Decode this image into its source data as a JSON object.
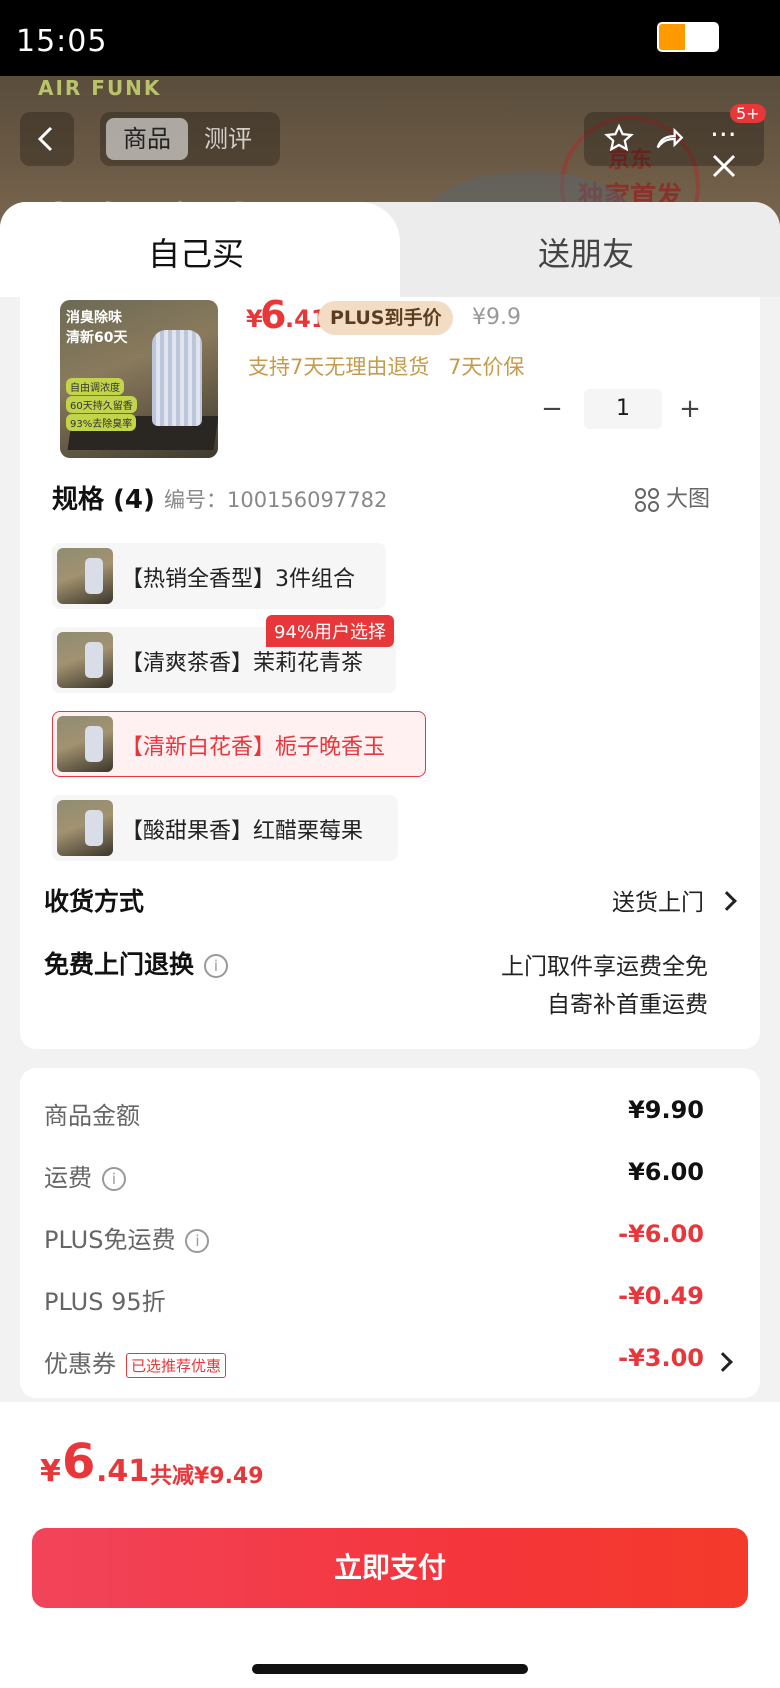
{
  "status_bar": {
    "time": "15:05",
    "battery_level": 0.45,
    "battery_color": "#ff9900"
  },
  "background_page": {
    "brand": "AIR FUNK",
    "tabs": [
      "商品",
      "测评"
    ],
    "badge": "5+",
    "stamp": [
      "京东",
      "独家首发"
    ],
    "headline": "消臭除味"
  },
  "sheet_tabs": {
    "self": "自己买",
    "gift": "送朋友"
  },
  "product": {
    "image_text": [
      "消臭除味",
      "清新60天",
      "自由调浓度",
      "60天持久留香",
      "93%去除臭率"
    ],
    "price_currency": "¥",
    "price_int": "6",
    "price_dec": ".41",
    "plus_tag": "PLUS到手价",
    "original_price": "¥9.9",
    "policies": [
      "支持7天无理由退货",
      "7天价保"
    ],
    "quantity": "1",
    "qty_minus": "−",
    "qty_plus": "+"
  },
  "specs": {
    "title": "规格 (4)",
    "code": "编号：100156097782",
    "big_view": "大图",
    "popular_tag": "94%用户选择",
    "options": [
      {
        "label": "【热销全香型】3件组合",
        "selected": false
      },
      {
        "label": "【清爽茶香】茉莉花青茶",
        "selected": false
      },
      {
        "label": "【清新白花香】栀子晚香玉",
        "selected": true
      },
      {
        "label": "【酸甜果香】红醋栗莓果",
        "selected": false
      }
    ]
  },
  "delivery": {
    "label": "收货方式",
    "value": "送货上门"
  },
  "return": {
    "label": "免费上门退换",
    "info": "i",
    "line1": "上门取件享运费全免",
    "line2": "自寄补首重运费"
  },
  "fees": {
    "goods_label": "商品金额",
    "goods_value": "¥9.90",
    "shipping_label": "运费",
    "shipping_value": "¥6.00",
    "plus_free_label": "PLUS免运费",
    "plus_free_value": "-¥6.00",
    "plus_discount_label": "PLUS 95折",
    "plus_discount_value": "-¥0.49",
    "coupon_label": "优惠券",
    "coupon_tag": "已选推荐优惠",
    "coupon_value": "-¥3.00",
    "info": "i"
  },
  "footer": {
    "total_currency": "¥",
    "total_int": "6",
    "total_dec": ".41",
    "saved": "共减¥9.49",
    "pay_button": "立即支付"
  },
  "colors": {
    "accent": "#e8373a",
    "gold": "#c69b4a"
  }
}
